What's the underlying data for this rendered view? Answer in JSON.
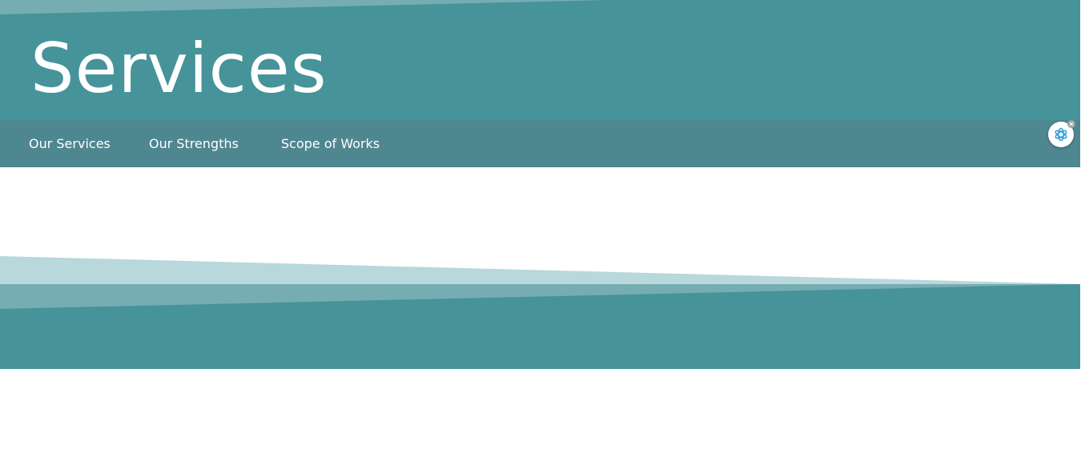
{
  "hero": {
    "title": "Services"
  },
  "subnav": {
    "items": [
      {
        "label": "Our Services"
      },
      {
        "label": "Our Strengths"
      },
      {
        "label": "Scope of Works"
      }
    ]
  },
  "widget": {
    "icon": "openai-logo-icon",
    "close_icon": "close-icon"
  },
  "colors": {
    "teal": "#46939a",
    "nav_teal": "#4f8791",
    "light_teal": "#b8d8db",
    "mid_teal": "#75adb2",
    "text": "#ffffff"
  }
}
